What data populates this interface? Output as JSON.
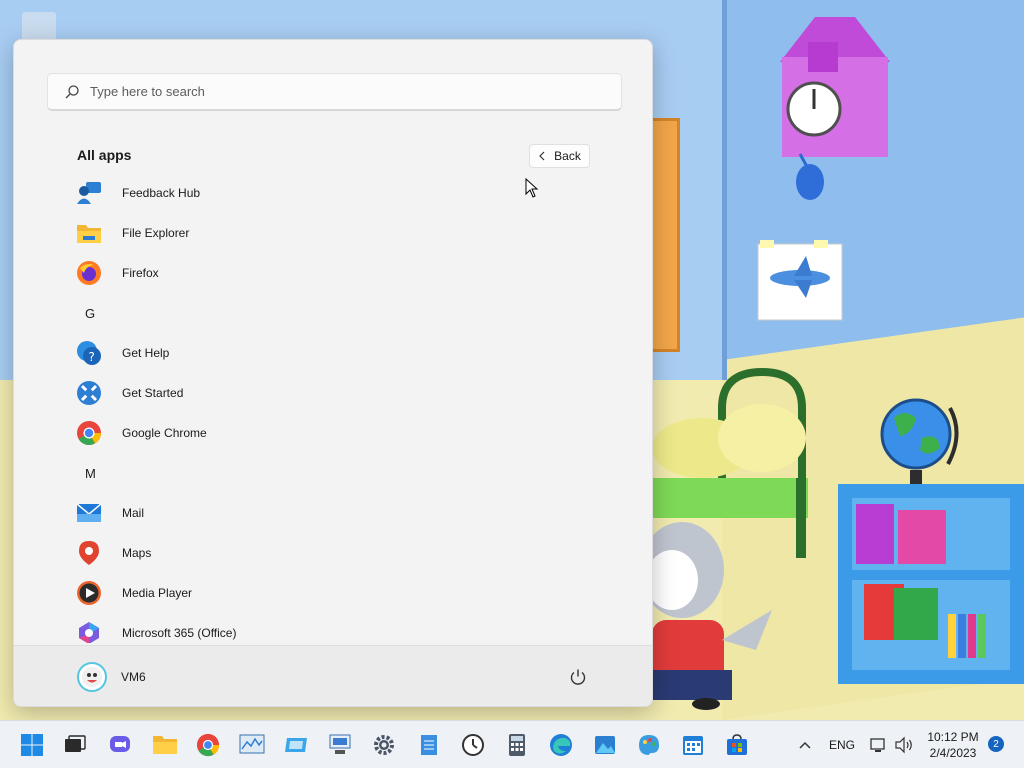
{
  "search": {
    "placeholder": "Type here to search"
  },
  "all_apps": {
    "title": "All apps",
    "back_label": "Back"
  },
  "apps": [
    {
      "label": "Feedback Hub"
    },
    {
      "label": "File Explorer"
    },
    {
      "label": "Firefox"
    },
    {
      "letter": "G"
    },
    {
      "label": "Get Help"
    },
    {
      "label": "Get Started"
    },
    {
      "label": "Google Chrome"
    },
    {
      "letter": "M"
    },
    {
      "label": "Mail"
    },
    {
      "label": "Maps"
    },
    {
      "label": "Media Player"
    },
    {
      "label": "Microsoft 365 (Office)"
    }
  ],
  "user": {
    "name": "VM6"
  },
  "taskbar": {
    "icons": [
      "windows-start-icon",
      "task-view-icon",
      "chat-icon",
      "file-explorer-icon",
      "chrome-icon",
      "resource-monitor-icon",
      "remote-desktop-icon",
      "network-icon",
      "settings-icon",
      "notepad-icon",
      "clock-icon",
      "calculator-icon",
      "edge-icon",
      "photos-icon",
      "paint-icon",
      "calendar-icon",
      "store-icon"
    ],
    "tray": {
      "language": "ENG",
      "time": "10:12 PM",
      "date": "2/4/2023",
      "notifications": "2"
    }
  }
}
